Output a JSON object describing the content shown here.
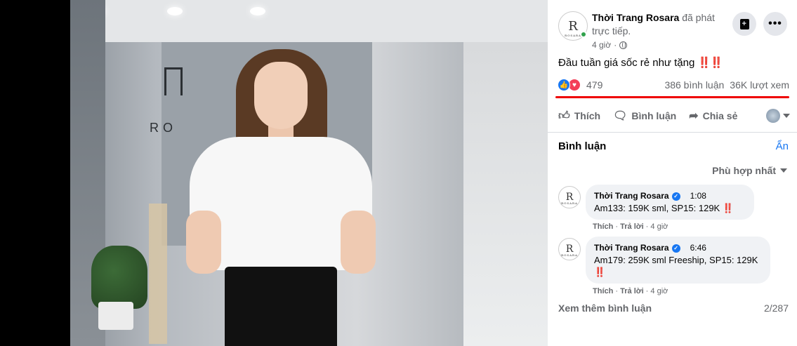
{
  "video": {
    "backdrop_logo_text": "RO"
  },
  "post": {
    "page_name": "Thời Trang Rosara",
    "action_text": "đã phát trực tiếp.",
    "time": "4 giờ",
    "text": "Đầu tuần giá sốc rẻ như tặng",
    "emoji": "‼️‼️",
    "reaction_count": "479",
    "comment_count": "386 bình luận",
    "view_count": "36K lượt xem",
    "avatar_letter": "R",
    "avatar_brand": "ROSARA"
  },
  "actions": {
    "like": "Thích",
    "comment": "Bình luận",
    "share": "Chia sẻ"
  },
  "comments_section": {
    "header": "Bình luận",
    "hide": "Ẩn",
    "sort": "Phù hợp nhất",
    "see_more": "Xem thêm bình luận",
    "count": "2/287",
    "items": [
      {
        "author": "Thời Trang Rosara",
        "timestamp": "1:08",
        "text": "Am133: 159K sml, SP15: 129K",
        "emoji": "‼️",
        "like": "Thích",
        "reply": "Trả lời",
        "age": "4 giờ"
      },
      {
        "author": "Thời Trang Rosara",
        "timestamp": "6:46",
        "text": "Am179: 259K sml Freeship, SP15: 129K",
        "emoji": "‼️",
        "like": "Thích",
        "reply": "Trả lời",
        "age": "4 giờ"
      }
    ]
  },
  "colors": {
    "accent": "#1877f2",
    "highlight_underline": "#ee0000",
    "online": "#31a24c"
  }
}
